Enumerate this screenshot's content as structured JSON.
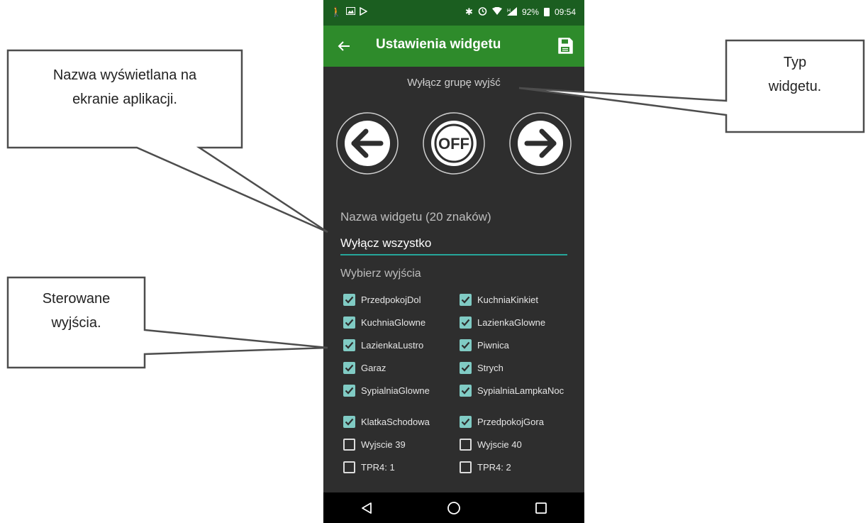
{
  "status_bar": {
    "time": "09:54",
    "battery": "92%"
  },
  "app_bar": {
    "title": "Ustawienia widgetu"
  },
  "widget_type": "Wyłącz grupę wyjść",
  "off_label": "OFF",
  "name_field": {
    "label": "Nazwa widgetu (20 znaków)",
    "value": "Wyłącz wszystko"
  },
  "outputs_label": "Wybierz wyjścia",
  "outputs": [
    {
      "left": "PrzedpokojDol",
      "left_checked": true,
      "right": "KuchniaKinkiet",
      "right_checked": true
    },
    {
      "left": "KuchniaGlowne",
      "left_checked": true,
      "right": "LazienkaGlowne",
      "right_checked": true
    },
    {
      "left": "LazienkaLustro",
      "left_checked": true,
      "right": "Piwnica",
      "right_checked": true
    },
    {
      "left": "Garaz",
      "left_checked": true,
      "right": "Strych",
      "right_checked": true
    },
    {
      "left": "SypialniaGlowne",
      "left_checked": true,
      "right": "SypialniaLampkaNoc",
      "right_checked": true
    },
    {
      "left": "KlatkaSchodowa",
      "left_checked": true,
      "right": "PrzedpokojGora",
      "right_checked": true
    },
    {
      "left": "Wyjscie 39",
      "left_checked": false,
      "right": "Wyjscie 40",
      "right_checked": false
    },
    {
      "left": "TPR4: 1",
      "left_checked": false,
      "right": "TPR4: 2",
      "right_checked": false
    }
  ],
  "callouts": {
    "name": {
      "line1": "Nazwa wyświetlana na",
      "line2": "ekranie aplikacji."
    },
    "type": {
      "line1": "Typ",
      "line2": "widgetu."
    },
    "outputs": {
      "line1": "Sterowane",
      "line2": "wyjścia."
    }
  },
  "colors": {
    "status_bar": "#1b5e20",
    "app_bar": "#2e8b2b",
    "background": "#2e2e2e",
    "accent": "#26a69a",
    "checkbox": "#80cbc4"
  }
}
